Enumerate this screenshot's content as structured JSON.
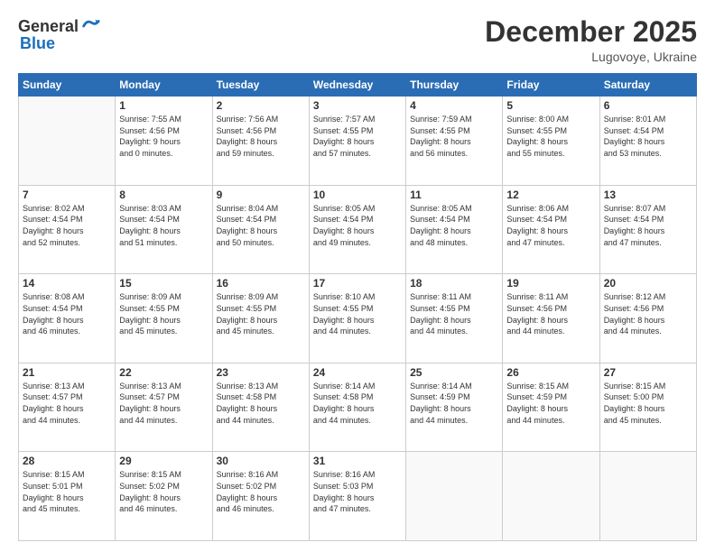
{
  "header": {
    "logo_general": "General",
    "logo_blue": "Blue",
    "month_title": "December 2025",
    "subtitle": "Lugovoye, Ukraine"
  },
  "days_of_week": [
    "Sunday",
    "Monday",
    "Tuesday",
    "Wednesday",
    "Thursday",
    "Friday",
    "Saturday"
  ],
  "weeks": [
    [
      {
        "day": "",
        "info": ""
      },
      {
        "day": "1",
        "info": "Sunrise: 7:55 AM\nSunset: 4:56 PM\nDaylight: 9 hours\nand 0 minutes."
      },
      {
        "day": "2",
        "info": "Sunrise: 7:56 AM\nSunset: 4:56 PM\nDaylight: 8 hours\nand 59 minutes."
      },
      {
        "day": "3",
        "info": "Sunrise: 7:57 AM\nSunset: 4:55 PM\nDaylight: 8 hours\nand 57 minutes."
      },
      {
        "day": "4",
        "info": "Sunrise: 7:59 AM\nSunset: 4:55 PM\nDaylight: 8 hours\nand 56 minutes."
      },
      {
        "day": "5",
        "info": "Sunrise: 8:00 AM\nSunset: 4:55 PM\nDaylight: 8 hours\nand 55 minutes."
      },
      {
        "day": "6",
        "info": "Sunrise: 8:01 AM\nSunset: 4:54 PM\nDaylight: 8 hours\nand 53 minutes."
      }
    ],
    [
      {
        "day": "7",
        "info": "Sunrise: 8:02 AM\nSunset: 4:54 PM\nDaylight: 8 hours\nand 52 minutes."
      },
      {
        "day": "8",
        "info": "Sunrise: 8:03 AM\nSunset: 4:54 PM\nDaylight: 8 hours\nand 51 minutes."
      },
      {
        "day": "9",
        "info": "Sunrise: 8:04 AM\nSunset: 4:54 PM\nDaylight: 8 hours\nand 50 minutes."
      },
      {
        "day": "10",
        "info": "Sunrise: 8:05 AM\nSunset: 4:54 PM\nDaylight: 8 hours\nand 49 minutes."
      },
      {
        "day": "11",
        "info": "Sunrise: 8:05 AM\nSunset: 4:54 PM\nDaylight: 8 hours\nand 48 minutes."
      },
      {
        "day": "12",
        "info": "Sunrise: 8:06 AM\nSunset: 4:54 PM\nDaylight: 8 hours\nand 47 minutes."
      },
      {
        "day": "13",
        "info": "Sunrise: 8:07 AM\nSunset: 4:54 PM\nDaylight: 8 hours\nand 47 minutes."
      }
    ],
    [
      {
        "day": "14",
        "info": "Sunrise: 8:08 AM\nSunset: 4:54 PM\nDaylight: 8 hours\nand 46 minutes."
      },
      {
        "day": "15",
        "info": "Sunrise: 8:09 AM\nSunset: 4:55 PM\nDaylight: 8 hours\nand 45 minutes."
      },
      {
        "day": "16",
        "info": "Sunrise: 8:09 AM\nSunset: 4:55 PM\nDaylight: 8 hours\nand 45 minutes."
      },
      {
        "day": "17",
        "info": "Sunrise: 8:10 AM\nSunset: 4:55 PM\nDaylight: 8 hours\nand 44 minutes."
      },
      {
        "day": "18",
        "info": "Sunrise: 8:11 AM\nSunset: 4:55 PM\nDaylight: 8 hours\nand 44 minutes."
      },
      {
        "day": "19",
        "info": "Sunrise: 8:11 AM\nSunset: 4:56 PM\nDaylight: 8 hours\nand 44 minutes."
      },
      {
        "day": "20",
        "info": "Sunrise: 8:12 AM\nSunset: 4:56 PM\nDaylight: 8 hours\nand 44 minutes."
      }
    ],
    [
      {
        "day": "21",
        "info": "Sunrise: 8:13 AM\nSunset: 4:57 PM\nDaylight: 8 hours\nand 44 minutes."
      },
      {
        "day": "22",
        "info": "Sunrise: 8:13 AM\nSunset: 4:57 PM\nDaylight: 8 hours\nand 44 minutes."
      },
      {
        "day": "23",
        "info": "Sunrise: 8:13 AM\nSunset: 4:58 PM\nDaylight: 8 hours\nand 44 minutes."
      },
      {
        "day": "24",
        "info": "Sunrise: 8:14 AM\nSunset: 4:58 PM\nDaylight: 8 hours\nand 44 minutes."
      },
      {
        "day": "25",
        "info": "Sunrise: 8:14 AM\nSunset: 4:59 PM\nDaylight: 8 hours\nand 44 minutes."
      },
      {
        "day": "26",
        "info": "Sunrise: 8:15 AM\nSunset: 4:59 PM\nDaylight: 8 hours\nand 44 minutes."
      },
      {
        "day": "27",
        "info": "Sunrise: 8:15 AM\nSunset: 5:00 PM\nDaylight: 8 hours\nand 45 minutes."
      }
    ],
    [
      {
        "day": "28",
        "info": "Sunrise: 8:15 AM\nSunset: 5:01 PM\nDaylight: 8 hours\nand 45 minutes."
      },
      {
        "day": "29",
        "info": "Sunrise: 8:15 AM\nSunset: 5:02 PM\nDaylight: 8 hours\nand 46 minutes."
      },
      {
        "day": "30",
        "info": "Sunrise: 8:16 AM\nSunset: 5:02 PM\nDaylight: 8 hours\nand 46 minutes."
      },
      {
        "day": "31",
        "info": "Sunrise: 8:16 AM\nSunset: 5:03 PM\nDaylight: 8 hours\nand 47 minutes."
      },
      {
        "day": "",
        "info": ""
      },
      {
        "day": "",
        "info": ""
      },
      {
        "day": "",
        "info": ""
      }
    ]
  ]
}
